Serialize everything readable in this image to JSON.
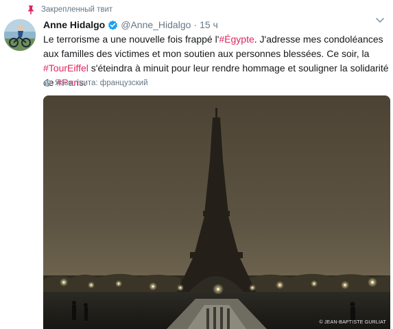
{
  "pinned": {
    "label": "Закрепленный твит",
    "icon": "pin-icon",
    "color": "#e0245e"
  },
  "author": {
    "name": "Anne Hidalgo",
    "handle": "@Anne_Hidalgo",
    "separator": "·",
    "time": "15 ч",
    "verified": true,
    "verified_color": "#1da1f2"
  },
  "tweet": {
    "segments": [
      {
        "text": "Le terrorisme a une nouvelle fois frappé l'",
        "hashtag": false
      },
      {
        "text": "#Égypte",
        "hashtag": true
      },
      {
        "text": ". J'adresse mes condoléances aux familles des victimes et mon soutien aux personnes blessées. Ce soir, la ",
        "hashtag": false
      },
      {
        "text": "#TourEiffel",
        "hashtag": true
      },
      {
        "text": " s'éteindra à minuit pour leur rendre hommage et souligner la solidarité de ",
        "hashtag": false
      },
      {
        "text": "#Paris",
        "hashtag": true
      },
      {
        "text": ".",
        "hashtag": false
      }
    ],
    "hashtag_color": "#e0245e"
  },
  "language": {
    "label": "Язык твита: французский",
    "icon": "globe-icon"
  },
  "photo": {
    "credit": "© JEAN-BAPTISTE GURLIAT"
  },
  "menu": {
    "icon": "chevron-down-icon"
  }
}
